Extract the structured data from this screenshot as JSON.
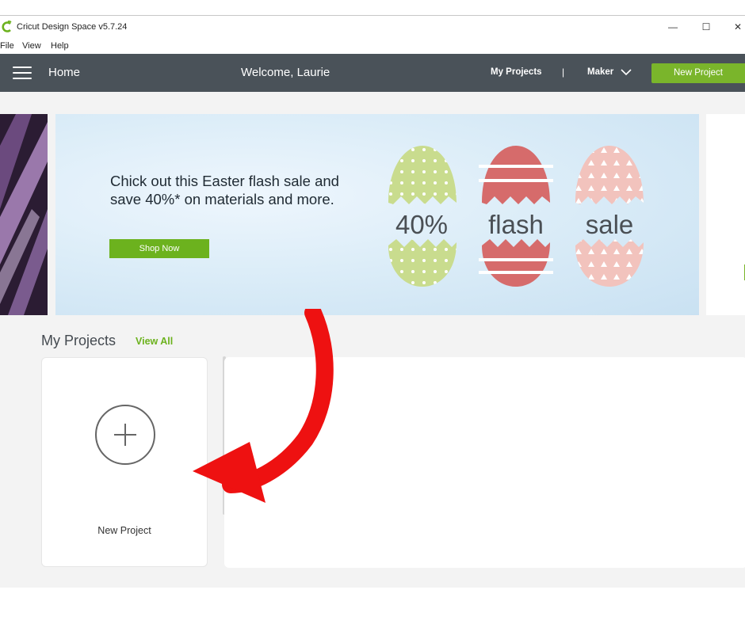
{
  "window": {
    "title": "Cricut Design Space  v5.7.24",
    "controls": {
      "minimize": "—",
      "maximize": "☐",
      "close": "✕"
    }
  },
  "menu": {
    "items": [
      "File",
      "View",
      "Help"
    ]
  },
  "header": {
    "home": "Home",
    "welcome": "Welcome, Laurie",
    "my_projects": "My Projects",
    "separator": "|",
    "machine": "Maker",
    "new_project": "New Project",
    "colors": {
      "bar": "#4a5259",
      "accent": "#7ab52b"
    }
  },
  "banner": {
    "headline": "Chick out this Easter flash sale and save 40%* on materials and more.",
    "cta": "Shop Now",
    "eggs": [
      {
        "label": "40%",
        "color": "#c9dc8e",
        "pattern": "dots"
      },
      {
        "label": "flash",
        "color": "#d66b6b",
        "pattern": "stripes"
      },
      {
        "label": "sale",
        "color": "#f2c3bd",
        "pattern": "triangles"
      }
    ]
  },
  "my_projects": {
    "title": "My Projects",
    "view_all": "View All",
    "new_project_card": "New Project"
  },
  "annotation": {
    "color": "#ee1111",
    "icon": "curved-arrow-icon"
  }
}
